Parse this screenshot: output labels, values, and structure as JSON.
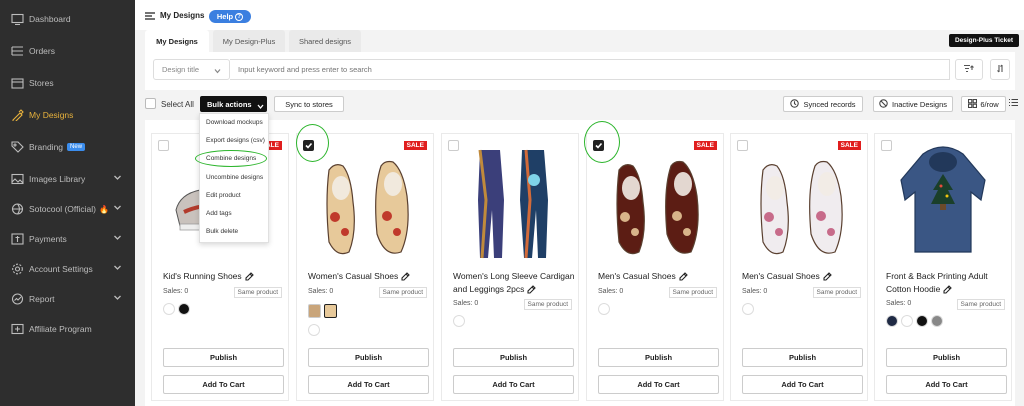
{
  "sidebar": {
    "items": [
      {
        "label": "Dashboard",
        "icon": "dashboard-icon",
        "active": false,
        "chevron": false
      },
      {
        "label": "Orders",
        "icon": "orders-icon",
        "active": false,
        "chevron": false
      },
      {
        "label": "Stores",
        "icon": "store-icon",
        "active": false,
        "chevron": false
      },
      {
        "label": "My Designs",
        "icon": "design-icon",
        "active": true,
        "chevron": false
      },
      {
        "label": "Branding",
        "icon": "tag-icon",
        "active": false,
        "chevron": false,
        "badge": "New"
      },
      {
        "label": "Images Library",
        "icon": "image-icon",
        "active": false,
        "chevron": true
      },
      {
        "label": "Sotocool (Official)",
        "icon": "globe-icon",
        "active": false,
        "chevron": true,
        "fire": true
      },
      {
        "label": "Payments",
        "icon": "payment-icon",
        "active": false,
        "chevron": true
      },
      {
        "label": "Account Settings",
        "icon": "gear-icon",
        "active": false,
        "chevron": true
      },
      {
        "label": "Report",
        "icon": "report-icon",
        "active": false,
        "chevron": true
      },
      {
        "label": "Affiliate Program",
        "icon": "affiliate-icon",
        "active": false,
        "chevron": false
      }
    ],
    "active_color": "#e8b23c"
  },
  "header": {
    "title": "My Designs",
    "help_label": "Help",
    "ticket_label": "Design-Plus Ticket"
  },
  "tabs": [
    {
      "label": "My Designs",
      "active": true
    },
    {
      "label": "My Design-Plus",
      "active": false
    },
    {
      "label": "Shared designs",
      "active": false
    }
  ],
  "search": {
    "field_select": "Design title",
    "placeholder": "Input keyword and press enter to search"
  },
  "toolbar": {
    "select_all": "Select All",
    "bulk_actions": "Bulk actions",
    "sync_to_stores": "Sync to stores",
    "synced_records": "Synced records",
    "inactive_designs": "Inactive Designs",
    "per_row": "6/row"
  },
  "bulk_menu": [
    "Download mockups",
    "Export designs (csv)",
    "Combine designs",
    "Uncombine designs",
    "Edit product",
    "Add tags",
    "Bulk delete"
  ],
  "cards": [
    {
      "title": "Kid's Running Shoes",
      "sale": "SALE",
      "checked": false,
      "sales": "Sales: 0",
      "tag": "Same product",
      "swatches": [
        "#ffffff",
        "#111111"
      ],
      "thumbs": false,
      "publish": "Publish",
      "cart": "Add To Cart"
    },
    {
      "title": "Women's Casual Shoes",
      "sale": "SALE",
      "checked": true,
      "sales": "Sales: 0",
      "tag": "Same product",
      "swatches": [],
      "thumbs": true,
      "publish": "Publish",
      "cart": "Add To Cart"
    },
    {
      "title": "Women's Long Sleeve Cardigan and Leggings 2pcs",
      "sale": "",
      "checked": false,
      "sales": "Sales: 0",
      "tag": "Same product",
      "swatches": [
        "#ffffff"
      ],
      "thumbs": false,
      "publish": "Publish",
      "cart": "Add To Cart"
    },
    {
      "title": "Men's Casual Shoes",
      "sale": "SALE",
      "checked": true,
      "sales": "Sales: 0",
      "tag": "Same product",
      "swatches": [
        "#ffffff"
      ],
      "thumbs": false,
      "publish": "Publish",
      "cart": "Add To Cart"
    },
    {
      "title": "Men's Casual Shoes",
      "sale": "SALE",
      "checked": false,
      "sales": "Sales: 0",
      "tag": "Same product",
      "swatches": [
        "#ffffff"
      ],
      "thumbs": false,
      "publish": "Publish",
      "cart": "Add To Cart"
    },
    {
      "title": "Front & Back Printing Adult Cotton Hoodie",
      "sale": "",
      "checked": false,
      "sales": "Sales: 0",
      "tag": "Same product",
      "swatches": [
        "#1f2a44",
        "#ffffff",
        "#111111",
        "#888888"
      ],
      "thumbs": false,
      "publish": "Publish",
      "cart": "Add To Cart"
    }
  ],
  "colors": {
    "sale": "#e01e1e",
    "help": "#3b7fe0",
    "annotation": "#2cb52c"
  }
}
